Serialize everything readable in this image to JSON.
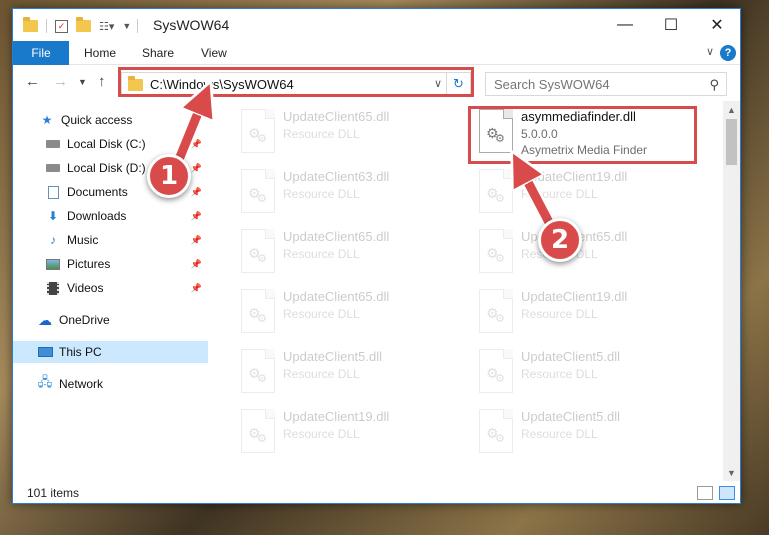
{
  "window": {
    "title": "SysWOW64",
    "minimize": "—",
    "maximize": "☐",
    "close": "✕"
  },
  "ribbon": {
    "tabs": [
      "File",
      "Home",
      "Share",
      "View"
    ],
    "help": "?"
  },
  "nav": {
    "address": "C:\\Windows\\SysWOW64",
    "search_placeholder": "Search SysWOW64"
  },
  "sidebar": {
    "items": [
      {
        "label": "Quick access",
        "icon": "star-icon",
        "pinned": false
      },
      {
        "label": "Local Disk (C:)",
        "icon": "drive-icon",
        "pinned": true
      },
      {
        "label": "Local Disk (D:)",
        "icon": "drive-icon",
        "pinned": true
      },
      {
        "label": "Documents",
        "icon": "documents-icon",
        "pinned": true
      },
      {
        "label": "Downloads",
        "icon": "download-icon",
        "pinned": true
      },
      {
        "label": "Music",
        "icon": "music-icon",
        "pinned": true
      },
      {
        "label": "Pictures",
        "icon": "pictures-icon",
        "pinned": true
      },
      {
        "label": "Videos",
        "icon": "videos-icon",
        "pinned": true
      },
      {
        "label": "OneDrive",
        "icon": "cloud-icon",
        "pinned": false
      },
      {
        "label": "This PC",
        "icon": "computer-icon",
        "pinned": false,
        "selected": true
      },
      {
        "label": "Network",
        "icon": "network-icon",
        "pinned": false
      }
    ]
  },
  "files": {
    "left": [
      {
        "name": "UpdateClient65.dll",
        "type": "Resource DLL"
      },
      {
        "name": "UpdateClient63.dll",
        "type": "Resource DLL"
      },
      {
        "name": "UpdateClient65.dll",
        "type": "Resource DLL"
      },
      {
        "name": "UpdateClient65.dll",
        "type": "Resource DLL"
      },
      {
        "name": "UpdateClient5.dll",
        "type": "Resource DLL"
      },
      {
        "name": "UpdateClient19.dll",
        "type": "Resource DLL"
      }
    ],
    "right": [
      {
        "name": "asymmediafinder.dll",
        "version": "5.0.0.0",
        "type": "Asymetrix Media Finder",
        "highlight": true
      },
      {
        "name": "UpdateClient19.dll",
        "type": "Resource DLL"
      },
      {
        "name": "UpdateClient65.dll",
        "type": "Resource DLL"
      },
      {
        "name": "UpdateClient19.dll",
        "type": "Resource DLL"
      },
      {
        "name": "UpdateClient5.dll",
        "type": "Resource DLL"
      },
      {
        "name": "UpdateClient5.dll",
        "type": "Resource DLL"
      }
    ]
  },
  "status": {
    "item_count": "101 items"
  },
  "annotations": {
    "step1": "1",
    "step2": "2",
    "color": "#d94b4b"
  }
}
